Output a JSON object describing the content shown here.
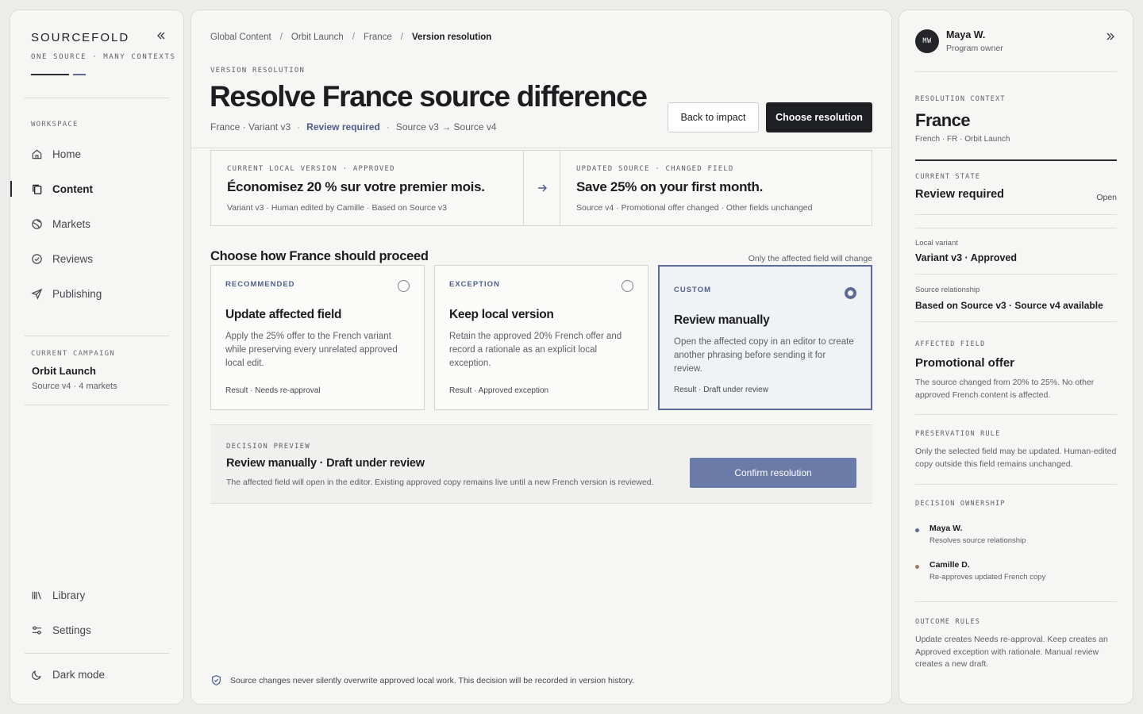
{
  "sidebar": {
    "brand": "SOURCEFOLD",
    "tagline": "ONE SOURCE · MANY CONTEXTS",
    "workspace_label": "WORKSPACE",
    "nav": [
      {
        "label": "Home",
        "icon": "home-icon"
      },
      {
        "label": "Content",
        "icon": "document-copy-icon",
        "active": true
      },
      {
        "label": "Markets",
        "icon": "globe-icon"
      },
      {
        "label": "Reviews",
        "icon": "check-circle-icon"
      },
      {
        "label": "Publishing",
        "icon": "send-icon"
      }
    ],
    "campaign_label": "CURRENT CAMPAIGN",
    "campaign_name": "Orbit Launch",
    "campaign_meta": "Source v4 · 4 markets",
    "footer_nav": [
      {
        "label": "Library",
        "icon": "library-icon"
      },
      {
        "label": "Settings",
        "icon": "sliders-icon"
      }
    ],
    "dark_mode_label": "Dark mode"
  },
  "main": {
    "breadcrumb": [
      "Global Content",
      "Orbit Launch",
      "France",
      "Version resolution"
    ],
    "eyebrow": "VERSION RESOLUTION",
    "title": "Resolve France source difference",
    "meta": {
      "variant": "France · Variant v3",
      "status": "Review required",
      "source": "Source v3 → Source v4"
    },
    "back_button": "Back to impact",
    "choose_button": "Choose resolution",
    "comparison": {
      "current": {
        "eyebrow": "CURRENT LOCAL VERSION · APPROVED",
        "text": "Économisez 20 % sur votre premier mois.",
        "meta": "Variant v3 · Human edited by Camille · Based on Source v3"
      },
      "updated": {
        "eyebrow": "UPDATED SOURCE · CHANGED FIELD",
        "text": "Save 25% on your first month.",
        "meta": "Source v4 · Promotional offer changed · Other fields unchanged"
      }
    },
    "choose_title": "Choose how France should proceed",
    "choose_note": "Only the affected field will change",
    "options": [
      {
        "tag": "RECOMMENDED",
        "title": "Update affected field",
        "desc": "Apply the 25% offer to the French variant while preserving every unrelated approved local edit.",
        "result": "Result · Needs re-approval",
        "selected": false
      },
      {
        "tag": "EXCEPTION",
        "title": "Keep local version",
        "desc": "Retain the approved 20% French offer and record a rationale as an explicit local exception.",
        "result": "Result · Approved exception",
        "selected": false
      },
      {
        "tag": "CUSTOM",
        "title": "Review manually",
        "desc": "Open the affected copy in an editor to create another phrasing before sending it for review.",
        "result": "Result · Draft under review",
        "selected": true
      }
    ],
    "decision": {
      "eyebrow": "DECISION PREVIEW",
      "title": "Review manually · Draft under review",
      "desc": "The affected field will open in the editor. Existing approved copy remains live until a new French version is reviewed.",
      "confirm_button": "Confirm resolution"
    },
    "footer_note": "Source changes never silently overwrite approved local work. This decision will be recorded in version history."
  },
  "right_panel": {
    "user": {
      "initials": "MW",
      "name": "Maya W.",
      "role": "Program owner"
    },
    "context_label": "RESOLUTION CONTEXT",
    "market": "France",
    "market_meta": "French · FR · Orbit Launch",
    "current_state_label": "CURRENT STATE",
    "current_state": "Review required",
    "current_state_badge": "Open",
    "local_variant_label": "Local variant",
    "local_variant": "Variant v3 · Approved",
    "source_rel_label": "Source relationship",
    "source_rel": "Based on Source v3 · Source v4 available",
    "affected_label": "AFFECTED FIELD",
    "affected_field": "Promotional offer",
    "affected_desc": "The source changed from 20% to 25%. No other approved French content is affected.",
    "preservation_label": "PRESERVATION RULE",
    "preservation_desc": "Only the selected field may be updated. Human-edited copy outside this field remains unchanged.",
    "ownership_label": "DECISION OWNERSHIP",
    "owners": [
      {
        "name": "Maya W.",
        "desc": "Resolves source relationship",
        "color": "#5b6b96"
      },
      {
        "name": "Camille D.",
        "desc": "Re-approves updated French copy",
        "color": "#a07a5a"
      }
    ],
    "outcome_label": "OUTCOME RULES",
    "outcome_desc": "Update creates Needs re-approval. Keep creates an Approved exception with rationale. Manual review creates a new draft."
  }
}
